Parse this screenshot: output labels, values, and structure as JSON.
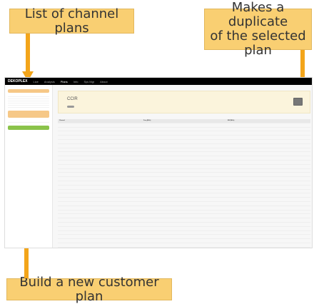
{
  "callouts": {
    "left": "List of channel plans",
    "right_line1": "Makes a duplicate",
    "right_line2": "of the selected plan",
    "bottom": "Build a new customer plan"
  },
  "app": {
    "nav": {
      "brand": "DEKOPLEX",
      "items": [
        "Live",
        "Analysis",
        "Plans",
        "Info",
        "Sys Mgr",
        "About"
      ]
    },
    "main": {
      "plan_title": "CCIR"
    },
    "table": {
      "headers": [
        "Channel",
        "Freq (MHz)",
        "BW (MHz)"
      ]
    }
  },
  "colors": {
    "callout_fill": "#f9cf72",
    "arrow": "#f3a51a",
    "nav_bar": "#000000",
    "sidebar_accent": "#f6c887",
    "new_plan_button": "#8bc34a"
  }
}
